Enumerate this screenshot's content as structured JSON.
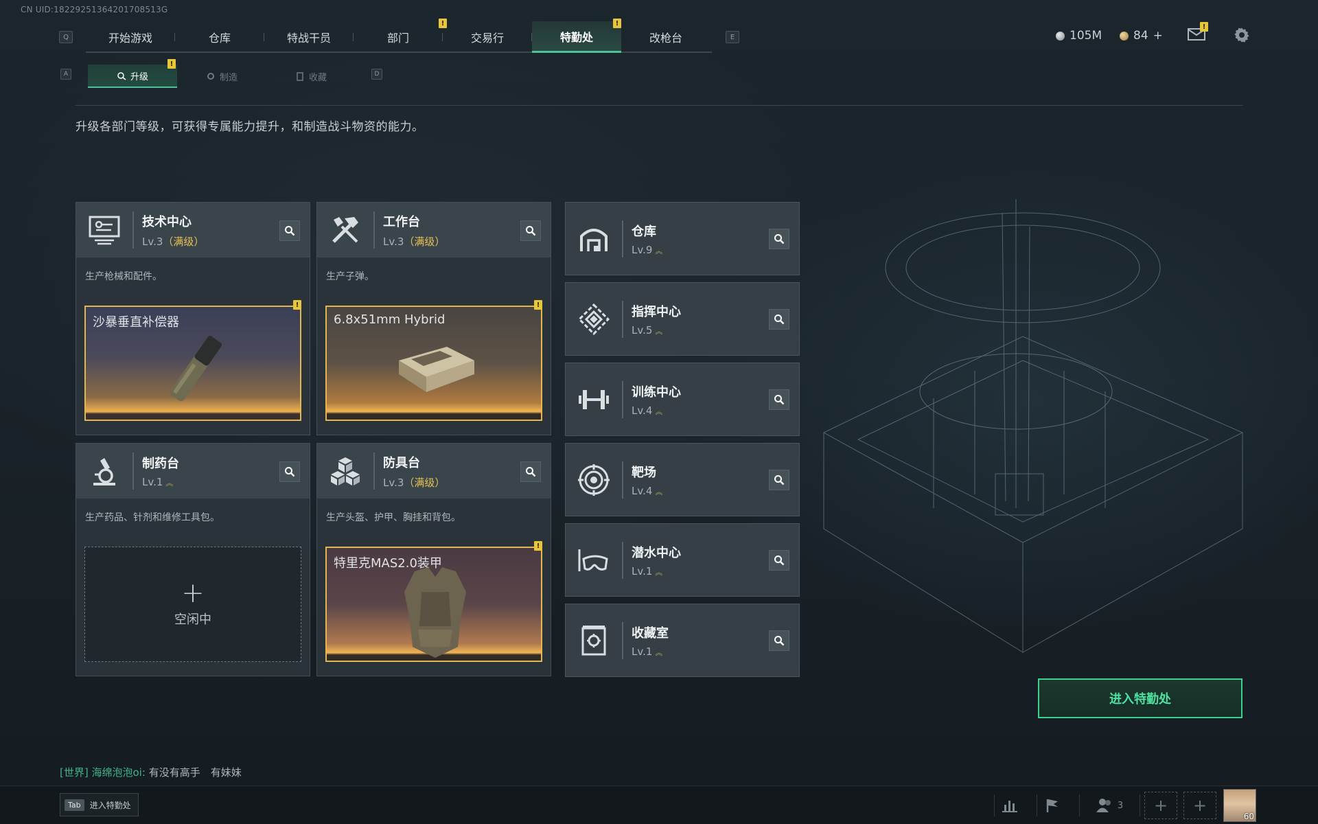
{
  "uid_text": "CN UID:18229251364201708513G",
  "keys": {
    "prev_tab": "Q",
    "next_tab": "E",
    "prev_sub": "A",
    "next_sub": "D"
  },
  "nav_tabs": [
    {
      "label": "开始游戏",
      "active": false
    },
    {
      "label": "仓库",
      "active": false
    },
    {
      "label": "特战干员",
      "active": false
    },
    {
      "label": "部门",
      "active": false,
      "badge": "!"
    },
    {
      "label": "交易行",
      "active": false
    },
    {
      "label": "特勤处",
      "active": true,
      "badge": "!"
    },
    {
      "label": "改枪台",
      "active": false
    }
  ],
  "sub_tabs": [
    {
      "label": "升级",
      "active": true,
      "badge": "!"
    },
    {
      "label": "制造",
      "active": false
    },
    {
      "label": "收藏",
      "active": false
    }
  ],
  "currency": {
    "silver": "105M",
    "gold": "84",
    "gold_plus": "+"
  },
  "mail_badge": "!",
  "description": "升级各部门等级，可获得专属能力提升，和制造战斗物资的能力。",
  "workstations": [
    {
      "name": "技术中心",
      "level": "Lv.3",
      "maxed": "（满级）",
      "desc": "生产枪械和配件。",
      "slot_label": "沙暴垂直补偿器",
      "slot_badge": "!",
      "icon": "monitor-icon"
    },
    {
      "name": "工作台",
      "level": "Lv.3",
      "maxed": "（满级）",
      "desc": "生产子弹。",
      "slot_label": "6.8x51mm Hybrid",
      "slot_badge": "!",
      "icon": "tools-icon"
    },
    {
      "name": "制药台",
      "level": "Lv.1",
      "desc": "生产药品、针剂和维修工具包。",
      "idle_plus": "+",
      "idle_label": "空闲中",
      "icon": "microscope-icon"
    },
    {
      "name": "防具台",
      "level": "Lv.3",
      "maxed": "（满级）",
      "desc": "生产头盔、护甲、胸挂和背包。",
      "slot_label": "特里克MAS2.0装甲",
      "slot_badge": "!",
      "icon": "cubes-icon"
    }
  ],
  "facilities": [
    {
      "name": "仓库",
      "level": "Lv.9",
      "icon": "warehouse-icon"
    },
    {
      "name": "指挥中心",
      "level": "Lv.5",
      "icon": "command-icon"
    },
    {
      "name": "训练中心",
      "level": "Lv.4",
      "icon": "dumbbell-icon"
    },
    {
      "name": "靶场",
      "level": "Lv.4",
      "icon": "target-icon"
    },
    {
      "name": "潜水中心",
      "level": "Lv.1",
      "icon": "diving-mask-icon"
    },
    {
      "name": "收藏室",
      "level": "Lv.1",
      "icon": "vault-icon"
    }
  ],
  "enter_button": "进入特勤处",
  "chat": {
    "channel": "[世界]",
    "user": "海绵泡泡oi:",
    "message": "有没有高手　有妹妹"
  },
  "bottom": {
    "tab_key": "Tab",
    "tab_label": "进入特勤处",
    "team_count": "3",
    "dashed_plus": "+",
    "avatar_level": "60"
  },
  "colors": {
    "accent": "#4fc197",
    "maxed": "#e8c155",
    "badge": "#e7c63a",
    "enter": "#3ad28f"
  }
}
